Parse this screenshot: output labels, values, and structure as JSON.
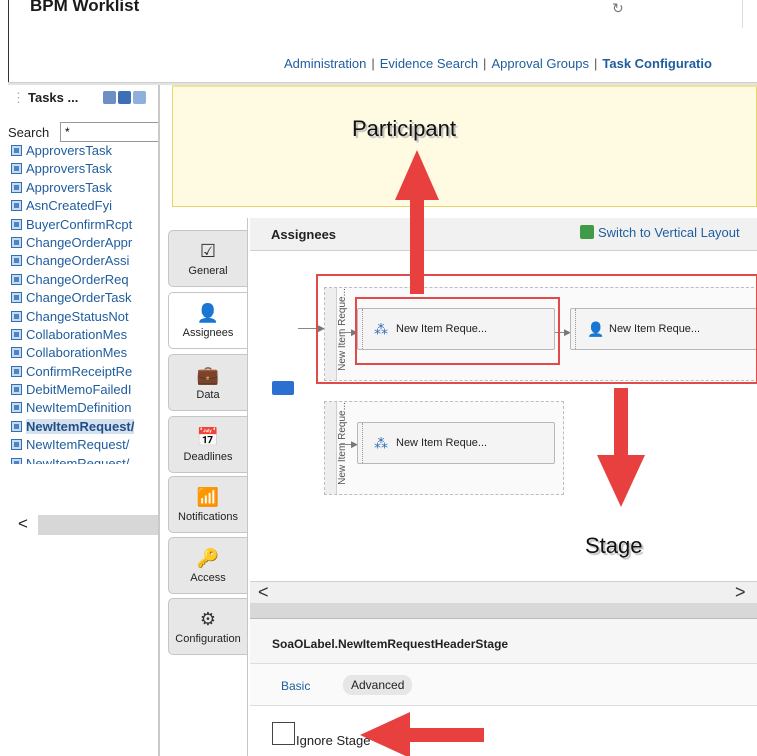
{
  "header": {
    "app_title": "BPM Worklist",
    "nav": {
      "administration": "Administration",
      "evidence_search": "Evidence Search",
      "approval_groups": "Approval Groups",
      "task_configuration": "Task Configuratio",
      "separator": "|"
    }
  },
  "tasks_panel": {
    "title": "Tasks ...",
    "search_label": "Search",
    "search_value": "*",
    "items": [
      {
        "label": "ApproversTask",
        "selected": false
      },
      {
        "label": "ApproversTask",
        "selected": false
      },
      {
        "label": "ApproversTask",
        "selected": false
      },
      {
        "label": "AsnCreatedFyi",
        "selected": false
      },
      {
        "label": "BuyerConfirmRcpt",
        "selected": false
      },
      {
        "label": "ChangeOrderAppr",
        "selected": false
      },
      {
        "label": "ChangeOrderAssi",
        "selected": false
      },
      {
        "label": "ChangeOrderReq",
        "selected": false
      },
      {
        "label": "ChangeOrderTask",
        "selected": false
      },
      {
        "label": "ChangeStatusNot",
        "selected": false
      },
      {
        "label": "CollaborationMes",
        "selected": false
      },
      {
        "label": "CollaborationMes",
        "selected": false
      },
      {
        "label": "ConfirmReceiptRe",
        "selected": false
      },
      {
        "label": "DebitMemoFailedI",
        "selected": false
      },
      {
        "label": "NewItemDefinition",
        "selected": false
      },
      {
        "label": "NewItemRequest/",
        "selected": true
      },
      {
        "label": "NewItemRequest/",
        "selected": false
      },
      {
        "label": "NewItemRequest/",
        "selected": false
      }
    ],
    "scroll_left_glyph": "<"
  },
  "vertical_tabs": [
    {
      "label": "General",
      "icon": "clipboard-check-icon",
      "glyph": "☑",
      "active": false
    },
    {
      "label": "Assignees",
      "icon": "person-icon",
      "glyph": "👤",
      "active": true
    },
    {
      "label": "Data",
      "icon": "briefcase-icon",
      "glyph": "💼",
      "active": false
    },
    {
      "label": "Deadlines",
      "icon": "calendar-icon",
      "glyph": "📅",
      "active": false
    },
    {
      "label": "Notifications",
      "icon": "rss-icon",
      "glyph": "📶",
      "active": false
    },
    {
      "label": "Access",
      "icon": "key-icon",
      "glyph": "🔑",
      "active": false
    },
    {
      "label": "Configuration",
      "icon": "gear-icon",
      "glyph": "⚙",
      "active": false
    }
  ],
  "assignees": {
    "title": "Assignees",
    "switch_layout": "Switch to Vertical Layout",
    "stages": [
      {
        "label": "New Item Reque...",
        "participants": [
          {
            "label": "New Item Reque...",
            "icon": "group-icon"
          },
          {
            "label": "New Item Reque...",
            "icon": "user-icon"
          }
        ]
      },
      {
        "label": "New Item Reque...",
        "participants": [
          {
            "label": "New Item Reque...",
            "icon": "group-icon"
          }
        ]
      }
    ],
    "scroll_left_glyph": "<",
    "scroll_right_glyph": ">"
  },
  "stage_properties": {
    "title": "SoaOLabel.NewItemRequestHeaderStage",
    "tabs": {
      "basic": "Basic",
      "advanced": "Advanced"
    },
    "ignore_stage_label": "Ignore Stage",
    "ignore_stage_checked": false
  },
  "annotations": {
    "participant": "Participant",
    "stage": "Stage",
    "arrow_color": "#e8403f"
  },
  "colors": {
    "link": "#1f5d9e",
    "highlight_box": "#e24a4a",
    "participant_area": "#fffbe3"
  }
}
